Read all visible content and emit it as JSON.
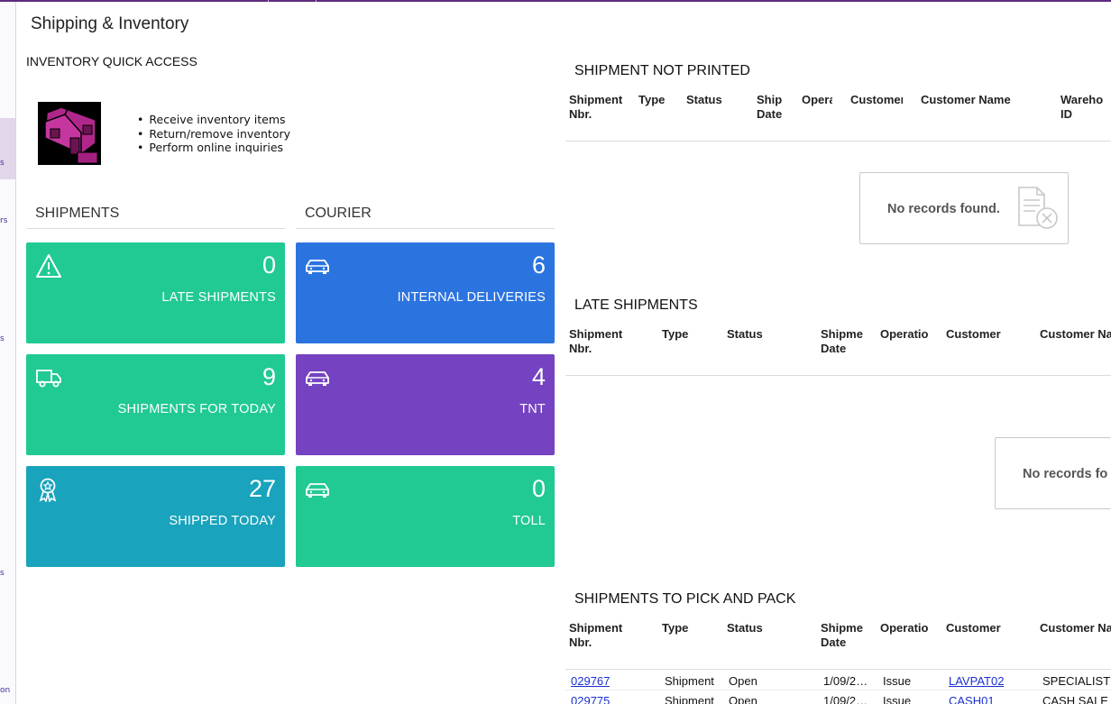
{
  "page": {
    "title": "Shipping & Inventory"
  },
  "leftnav": {
    "fragments": [
      "s",
      "rs",
      "s",
      "s",
      "on"
    ]
  },
  "inventory_quick_access": {
    "title": "INVENTORY QUICK ACCESS",
    "items": [
      "Receive inventory items",
      "Return/remove inventory",
      "Perform online inquiries"
    ]
  },
  "shipments": {
    "title": "SHIPMENTS",
    "tiles": [
      {
        "count": "0",
        "label": "LATE SHIPMENTS",
        "icon": "warning-icon",
        "color": "#21c993"
      },
      {
        "count": "9",
        "label": "SHIPMENTS FOR TODAY",
        "icon": "truck-icon",
        "color": "#21c993"
      },
      {
        "count": "27",
        "label": "SHIPPED TODAY",
        "icon": "award-icon",
        "color": "#19a3bc"
      }
    ]
  },
  "courier": {
    "title": "COURIER",
    "tiles": [
      {
        "count": "6",
        "label": "INTERNAL DELIVERIES",
        "icon": "car-icon",
        "color": "#2b74e0"
      },
      {
        "count": "4",
        "label": "TNT",
        "icon": "car-icon",
        "color": "#7543c2"
      },
      {
        "count": "0",
        "label": "TOLL",
        "icon": "car-icon",
        "color": "#21c993"
      }
    ]
  },
  "not_printed": {
    "title": "SHIPMENT NOT PRINTED",
    "columns": [
      "Shipment\nNbr.",
      "Type",
      "Status",
      "Ship\nDate",
      "Opera",
      "Customer",
      "Customer Name",
      "Wareho\nID"
    ],
    "empty_text": "No records found."
  },
  "late": {
    "title": "LATE SHIPMENTS",
    "columns": [
      "Shipment\nNbr.",
      "Type",
      "Status",
      "Shipme\nDate",
      "Operatio",
      "Customer",
      "Customer Na"
    ],
    "empty_text": "No records fo"
  },
  "pick_pack": {
    "title": "SHIPMENTS TO PICK AND PACK",
    "columns": [
      "Shipment\nNbr.",
      "Type",
      "Status",
      "Shipme\nDate",
      "Operatio",
      "Customer",
      "Customer Na"
    ],
    "rows": [
      {
        "nbr": "029767",
        "type": "Shipment",
        "status": "Open",
        "date": "1/09/2…",
        "op": "Issue",
        "customer": "LAVPAT02",
        "name": "SPECIALIST"
      },
      {
        "nbr": "029775",
        "type": "Shipment",
        "status": "Open",
        "date": "1/09/2…",
        "op": "Issue",
        "customer": "CASH01",
        "name": "CASH SALE"
      }
    ]
  }
}
